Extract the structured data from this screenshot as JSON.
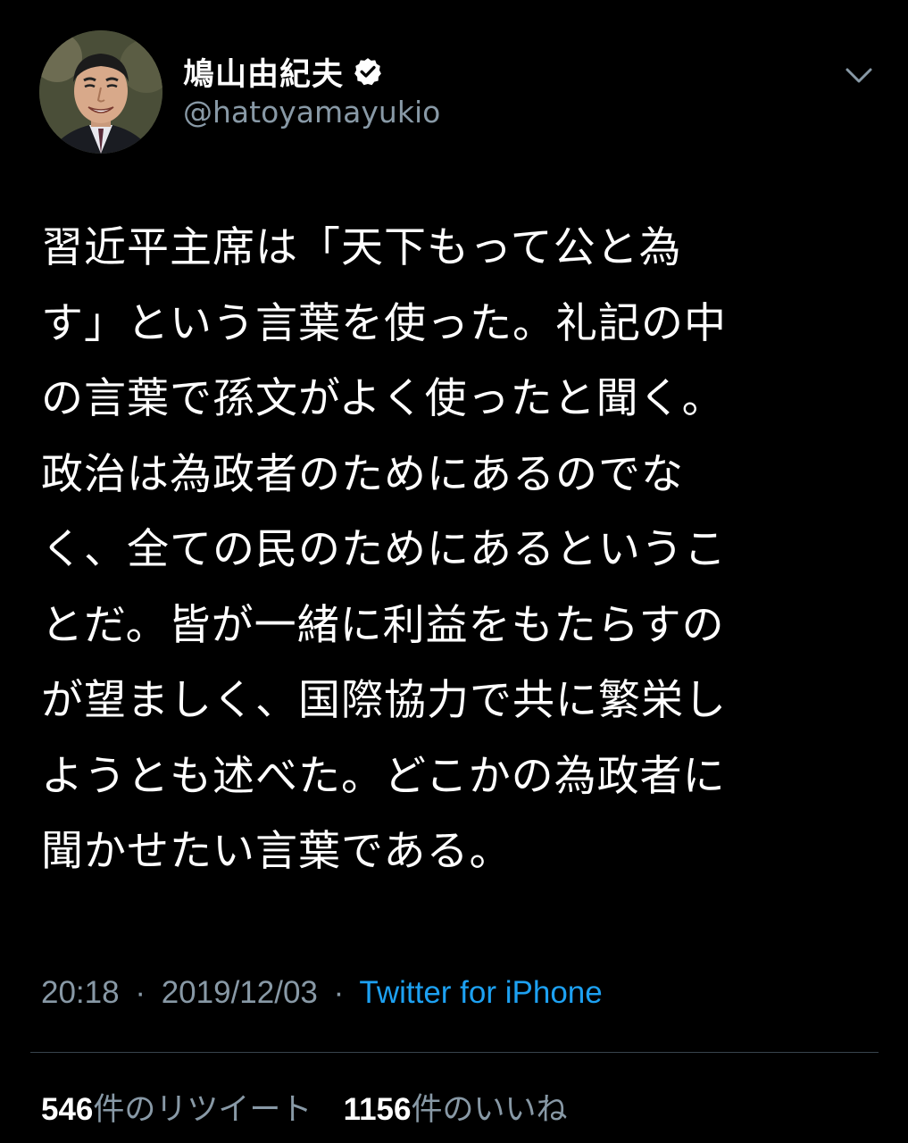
{
  "author": {
    "display_name": "鳩山由紀夫",
    "handle": "@hatoyamayukio",
    "verified": true
  },
  "tweet": {
    "lines": [
      "習近平主席は「天下もって公と為",
      "す」という言葉を使った。礼記の中",
      "の言葉で孫文がよく使ったと聞く。",
      "政治は為政者のためにあるのでな",
      "く、全ての民のためにあるというこ",
      "とだ。皆が一緒に利益をもたらすの",
      "が望ましく、国際協力で共に繁栄し",
      "ようとも述べた。どこかの為政者に",
      "聞かせたい言葉である。"
    ],
    "time": "20:18",
    "date": "2019/12/03",
    "separator": "·",
    "source": "Twitter for iPhone"
  },
  "stats": {
    "retweets_count": "546",
    "retweets_label": "件のリツイート",
    "likes_count": "1156",
    "likes_label": "件のいいね"
  },
  "colors": {
    "background": "#000000",
    "primary_text": "#ffffff",
    "secondary_text": "#8899a6",
    "link": "#1da1f2",
    "divider": "#38444d"
  },
  "icons": {
    "verified": "verified-badge-icon",
    "more": "chevron-down-icon"
  }
}
